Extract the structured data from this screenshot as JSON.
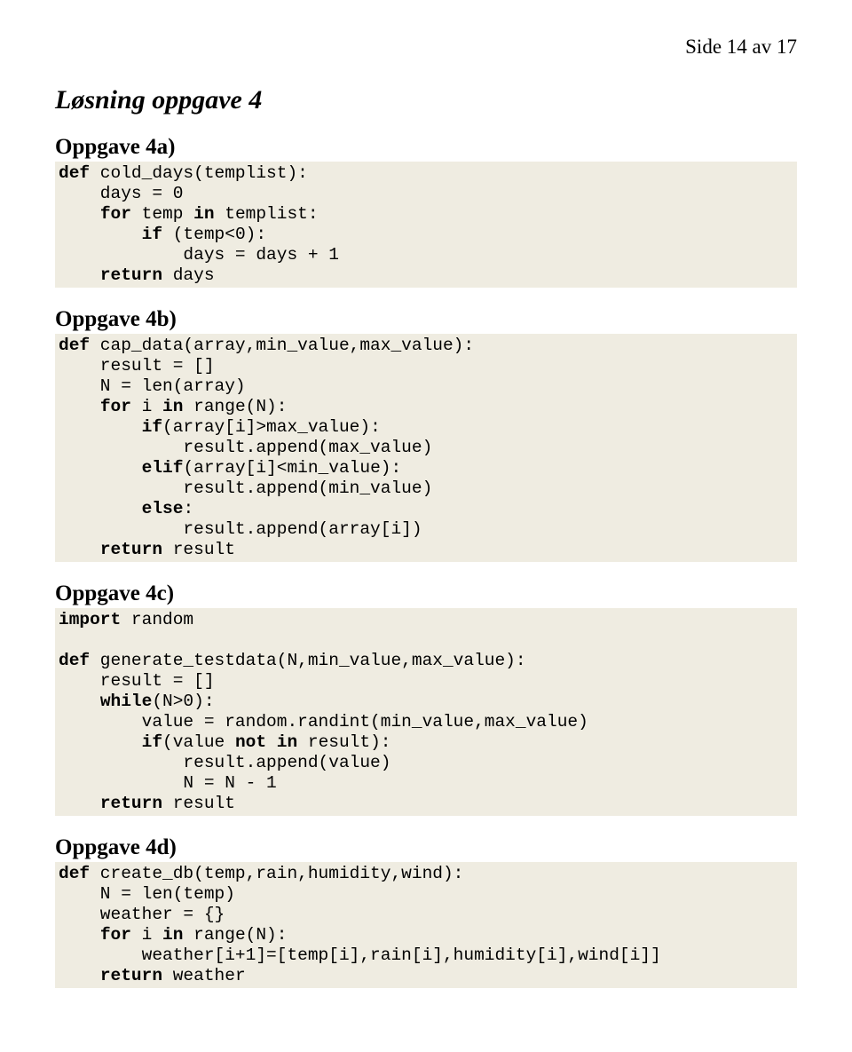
{
  "header": {
    "page_label": "Side 14 av 17"
  },
  "section": {
    "title": "Løsning oppgave 4"
  },
  "parts": {
    "a": {
      "title": "Oppgave 4a)"
    },
    "b": {
      "title": "Oppgave 4b)"
    },
    "c": {
      "title": "Oppgave 4c)"
    },
    "d": {
      "title": "Oppgave 4d)"
    }
  },
  "code": {
    "a": {
      "tokens": [
        [
          "def",
          "kw"
        ],
        [
          " cold_days(templist):",
          ""
        ],
        [
          "\n",
          ""
        ],
        [
          "    days = 0",
          ""
        ],
        [
          "\n",
          ""
        ],
        [
          "    ",
          ""
        ],
        [
          "for",
          "kw"
        ],
        [
          " temp ",
          ""
        ],
        [
          "in",
          "kw"
        ],
        [
          " templist:",
          ""
        ],
        [
          "\n",
          ""
        ],
        [
          "        ",
          ""
        ],
        [
          "if",
          "kw"
        ],
        [
          " (temp<0):",
          ""
        ],
        [
          "\n",
          ""
        ],
        [
          "            days = days + 1",
          ""
        ],
        [
          "\n",
          ""
        ],
        [
          "    ",
          ""
        ],
        [
          "return",
          "kw"
        ],
        [
          " days",
          ""
        ]
      ]
    },
    "b": {
      "tokens": [
        [
          "def",
          "kw"
        ],
        [
          " cap_data(array,min_value,max_value):",
          ""
        ],
        [
          "\n",
          ""
        ],
        [
          "    result = []",
          ""
        ],
        [
          "\n",
          ""
        ],
        [
          "    N = len(array)",
          ""
        ],
        [
          "\n",
          ""
        ],
        [
          "    ",
          ""
        ],
        [
          "for",
          "kw"
        ],
        [
          " i ",
          ""
        ],
        [
          "in",
          "kw"
        ],
        [
          " range(N):",
          ""
        ],
        [
          "\n",
          ""
        ],
        [
          "        ",
          ""
        ],
        [
          "if",
          "kw"
        ],
        [
          "(array[i]>max_value):",
          ""
        ],
        [
          "\n",
          ""
        ],
        [
          "            result.append(max_value)",
          ""
        ],
        [
          "\n",
          ""
        ],
        [
          "        ",
          ""
        ],
        [
          "elif",
          "kw"
        ],
        [
          "(array[i]<min_value):",
          ""
        ],
        [
          "\n",
          ""
        ],
        [
          "            result.append(min_value)",
          ""
        ],
        [
          "\n",
          ""
        ],
        [
          "        ",
          ""
        ],
        [
          "else",
          "kw"
        ],
        [
          ":",
          ""
        ],
        [
          "\n",
          ""
        ],
        [
          "            result.append(array[i])",
          ""
        ],
        [
          "\n",
          ""
        ],
        [
          "    ",
          ""
        ],
        [
          "return",
          "kw"
        ],
        [
          " result",
          ""
        ]
      ]
    },
    "c": {
      "tokens": [
        [
          "import",
          "kw"
        ],
        [
          " random",
          ""
        ],
        [
          "\n",
          ""
        ],
        [
          "",
          ""
        ],
        [
          "\n",
          ""
        ],
        [
          "def",
          "kw"
        ],
        [
          " generate_testdata(N,min_value,max_value):",
          ""
        ],
        [
          "\n",
          ""
        ],
        [
          "    result = []",
          ""
        ],
        [
          "\n",
          ""
        ],
        [
          "    ",
          ""
        ],
        [
          "while",
          "kw"
        ],
        [
          "(N>0):",
          ""
        ],
        [
          "\n",
          ""
        ],
        [
          "        value = random.randint(min_value,max_value)",
          ""
        ],
        [
          "\n",
          ""
        ],
        [
          "        ",
          ""
        ],
        [
          "if",
          "kw"
        ],
        [
          "(value ",
          ""
        ],
        [
          "not in",
          "kw"
        ],
        [
          " result):",
          ""
        ],
        [
          "\n",
          ""
        ],
        [
          "            result.append(value)",
          ""
        ],
        [
          "\n",
          ""
        ],
        [
          "            N = N - 1",
          ""
        ],
        [
          "\n",
          ""
        ],
        [
          "    ",
          ""
        ],
        [
          "return",
          "kw"
        ],
        [
          " result",
          ""
        ]
      ]
    },
    "d": {
      "tokens": [
        [
          "def",
          "kw"
        ],
        [
          " create_db(temp,rain,humidity,wind):",
          ""
        ],
        [
          "\n",
          ""
        ],
        [
          "    N = len(temp)",
          ""
        ],
        [
          "\n",
          ""
        ],
        [
          "    weather = {}",
          ""
        ],
        [
          "\n",
          ""
        ],
        [
          "    ",
          ""
        ],
        [
          "for",
          "kw"
        ],
        [
          " i ",
          ""
        ],
        [
          "in",
          "kw"
        ],
        [
          " range(N):",
          ""
        ],
        [
          "\n",
          ""
        ],
        [
          "        weather[i+1]=[temp[i],rain[i],humidity[i],wind[i]]",
          ""
        ],
        [
          "\n",
          ""
        ],
        [
          "    ",
          ""
        ],
        [
          "return",
          "kw"
        ],
        [
          " weather",
          ""
        ]
      ]
    }
  }
}
